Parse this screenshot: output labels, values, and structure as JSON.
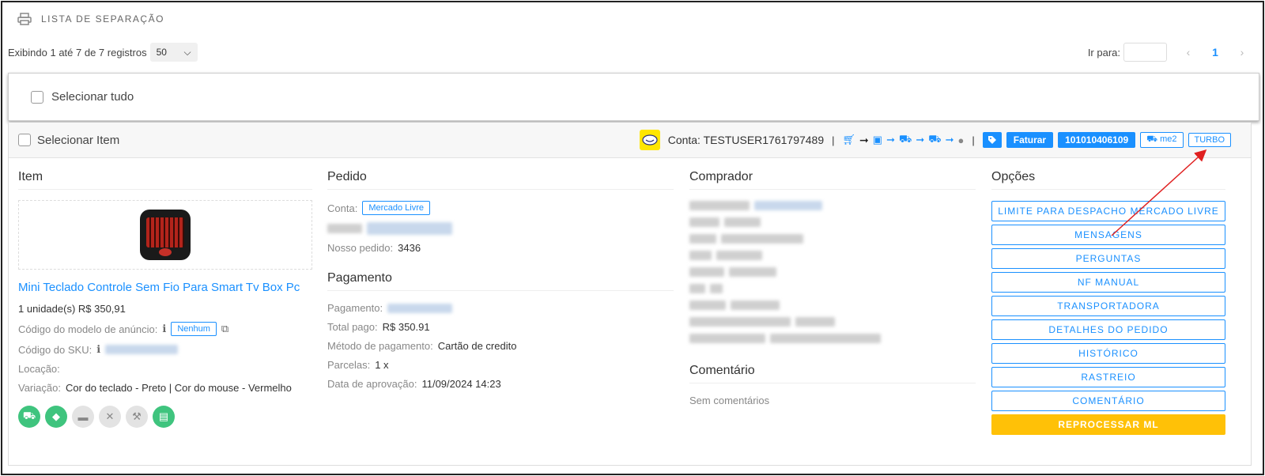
{
  "header": {
    "title": "LISTA DE SEPARAÇÃO",
    "icon": "printer-icon"
  },
  "toolbar": {
    "records_text": "Exibindo 1 até 7 de 7 registros",
    "page_size": "50",
    "goto_label": "Ir para:",
    "goto_value": "",
    "current_page": "1"
  },
  "select_all": {
    "label": "Selecionar tudo"
  },
  "card": {
    "select_label": "Selecionar Item",
    "account": "Conta: TESTUSER1761797489",
    "separator": "|",
    "buttons": {
      "invoice": "Faturar",
      "order_id": "101010406109",
      "shipping": "me2",
      "turbo": "TURBO"
    }
  },
  "item": {
    "heading": "Item",
    "title": "Mini Teclado Controle Sem Fio Para Smart Tv Box Pc",
    "qty_price": "1 unidade(s) R$ 350,91",
    "model_label": "Código do modelo de anúncio:",
    "model_value": "Nenhum",
    "sku_label": "Código do SKU:",
    "location_label": "Locação:",
    "variation_label": "Variação:",
    "variation_value": "Cor do teclado - Preto | Cor do mouse - Vermelho"
  },
  "order": {
    "heading": "Pedido",
    "account_label": "Conta:",
    "account_value": "Mercado Livre",
    "our_order_label": "Nosso pedido:",
    "our_order_value": "3436"
  },
  "payment": {
    "heading": "Pagamento",
    "payment_label": "Pagamento:",
    "total_label": "Total pago:",
    "total_value": "R$ 350.91",
    "method_label": "Método de pagamento:",
    "method_value": "Cartão de credito",
    "installments_label": "Parcelas:",
    "installments_value": "1 x",
    "approval_label": "Data de aprovação:",
    "approval_value": "11/09/2024 14:23"
  },
  "buyer": {
    "heading": "Comprador"
  },
  "comment": {
    "heading": "Comentário",
    "text": "Sem comentários"
  },
  "options": {
    "heading": "Opções",
    "items": [
      "LIMITE PARA DESPACHO MERCADO LIVRE",
      "MENSAGENS",
      "PERGUNTAS",
      "NF MANUAL",
      "TRANSPORTADORA",
      "DETALHES DO PEDIDO",
      "HISTÓRICO",
      "RASTREIO",
      "COMENTÁRIO"
    ],
    "reprocess": "REPROCESSAR ML"
  },
  "colors": {
    "accent": "#1a90ff",
    "warning": "#ffc107",
    "success": "#3fc47e",
    "annotation": "#e02020"
  }
}
